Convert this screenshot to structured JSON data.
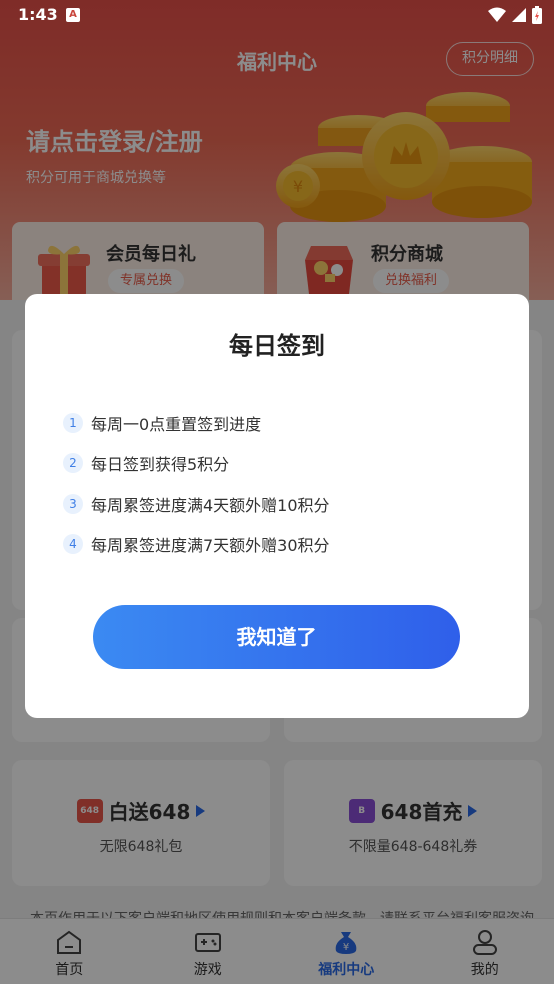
{
  "status_bar": {
    "time": "1:43",
    "badge": "A"
  },
  "header": {
    "title": "福利中心",
    "detail_button": "积分明细",
    "login_prompt": "请点击登录/注册",
    "login_sub": "积分可用于商城兑换等"
  },
  "feature_cards": [
    {
      "title": "会员每日礼",
      "pill": "专属兑换"
    },
    {
      "title": "积分商城",
      "pill": "兑换福利"
    }
  ],
  "promos": [
    {
      "icon_text": "648",
      "title": "白送648",
      "subtitle": "无限648礼包",
      "color": "#e9574a"
    },
    {
      "icon_text": "B",
      "title": "648首充",
      "subtitle": "不限量648-648礼券",
      "color": "#8a4fd8"
    }
  ],
  "ticker": "本页作用于以下客户端和地区使用规则和本客户端条款，请联系平台福利客服咨询",
  "bottom_nav": [
    {
      "label": "首页",
      "icon": "home-icon"
    },
    {
      "label": "游戏",
      "icon": "gamepad-icon"
    },
    {
      "label": "福利中心",
      "icon": "money-bag-icon",
      "active": true
    },
    {
      "label": "我的",
      "icon": "profile-icon"
    }
  ],
  "dialog": {
    "title": "每日签到",
    "rules": [
      {
        "num": "1",
        "text": "每周一0点重置签到进度"
      },
      {
        "num": "2",
        "text": "每日签到获得5积分"
      },
      {
        "num": "3",
        "text": "每周累签进度满4天额外赠10积分"
      },
      {
        "num": "4",
        "text": "每周累签进度满7天额外赠30积分"
      }
    ],
    "confirm_button": "我知道了"
  },
  "colors": {
    "accent": "#2f6bea",
    "header_red": "#e8504a"
  }
}
